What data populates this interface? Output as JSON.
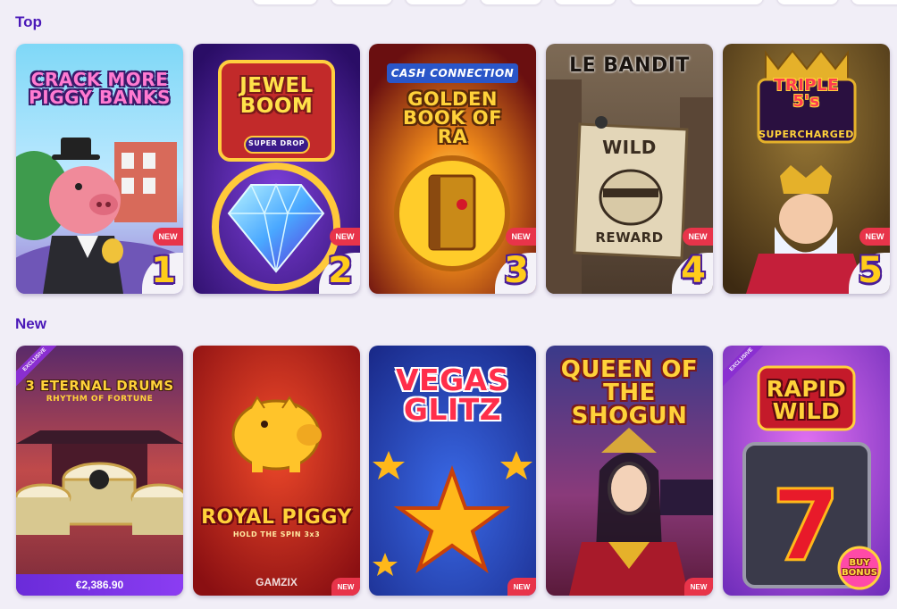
{
  "sections": {
    "top": {
      "title": "Top",
      "games": [
        {
          "name": "CRACK MORE PIGGY BANKS",
          "rank": "1",
          "badge": "NEW"
        },
        {
          "name": "JEWEL BOOM",
          "subtitle": "SUPER DROP",
          "rank": "2",
          "badge": "NEW"
        },
        {
          "name": "GOLDEN BOOK OF RA",
          "brand": "CASH CONNECTION",
          "rank": "3",
          "badge": "NEW"
        },
        {
          "name": "LE BANDIT",
          "sign_top": "WILD",
          "sign_bottom": "REWARD",
          "rank": "4",
          "badge": "NEW"
        },
        {
          "name": "TRIPLE 5's",
          "subtitle": "SUPERCHARGED",
          "rank": "5",
          "badge": "NEW"
        }
      ]
    },
    "new": {
      "title": "New",
      "games": [
        {
          "name": "3 ETERNAL DRUMS",
          "subtitle": "RHYTHM OF FORTUNE",
          "ribbon": "EXCLUSIVE",
          "jackpot": "€2,386.90"
        },
        {
          "name": "ROYAL PIGGY",
          "subtitle": "HOLD THE SPIN 3x3",
          "provider": "GAMZIX",
          "badge": "NEW"
        },
        {
          "name": "VEGAS GLITZ",
          "badge": "NEW"
        },
        {
          "name": "QUEEN OF THE SHOGUN",
          "badge": "NEW"
        },
        {
          "name": "RAPID WILD",
          "ribbon": "EXCLUSIVE",
          "bonus_top": "BUY",
          "bonus_bottom": "BONUS"
        }
      ]
    }
  },
  "colors": {
    "accent": "#4a18b8",
    "new_badge": "#e8344a",
    "rank_fill": "#ffcc1a",
    "background": "#f1eef7"
  },
  "icons": [
    "chevron-nav-pill"
  ]
}
